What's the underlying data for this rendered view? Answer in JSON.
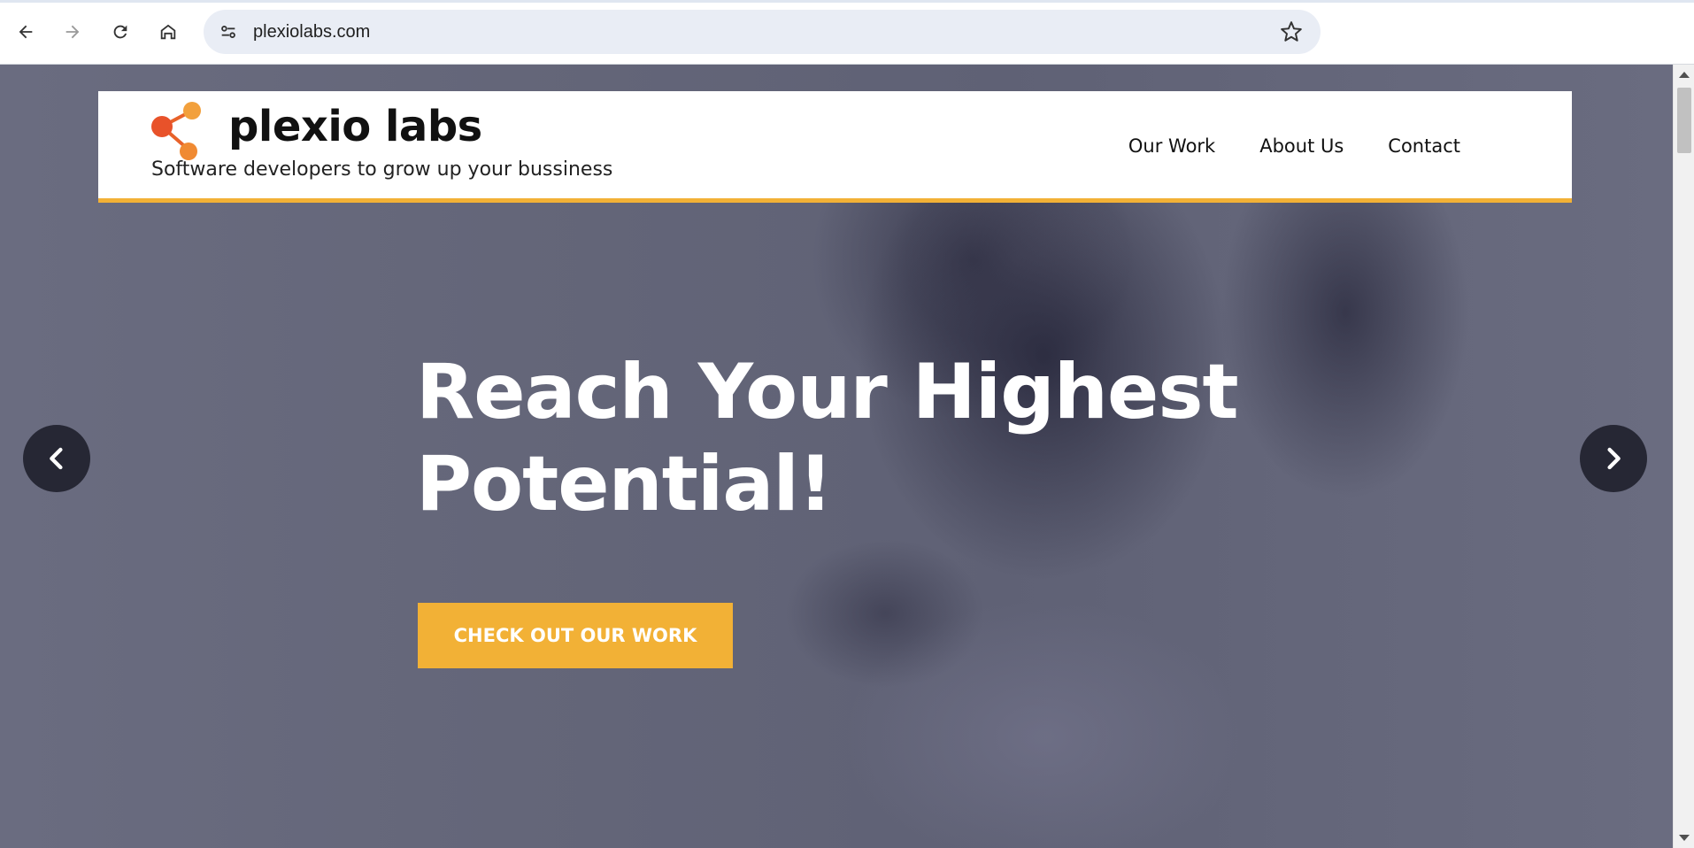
{
  "browser": {
    "url": "plexiolabs.com"
  },
  "site": {
    "brand_name": "plexio labs",
    "tagline": "Software developers to grow up your bussiness",
    "nav": [
      {
        "label": "Our Work"
      },
      {
        "label": "About Us"
      },
      {
        "label": "Contact"
      }
    ],
    "accent_color": "#f2b136"
  },
  "hero": {
    "title_line1": "Reach Your Highest",
    "title_line2": "Potential!",
    "cta_label": "CHECK OUT OUR WORK"
  },
  "icons": {
    "back": "arrow-left-icon",
    "forward": "arrow-right-icon",
    "reload": "reload-icon",
    "home": "home-icon",
    "site_info": "tune-icon",
    "bookmark": "star-icon",
    "logo": "share-network-icon",
    "carousel_prev": "chevron-left-icon",
    "carousel_next": "chevron-right-icon"
  }
}
